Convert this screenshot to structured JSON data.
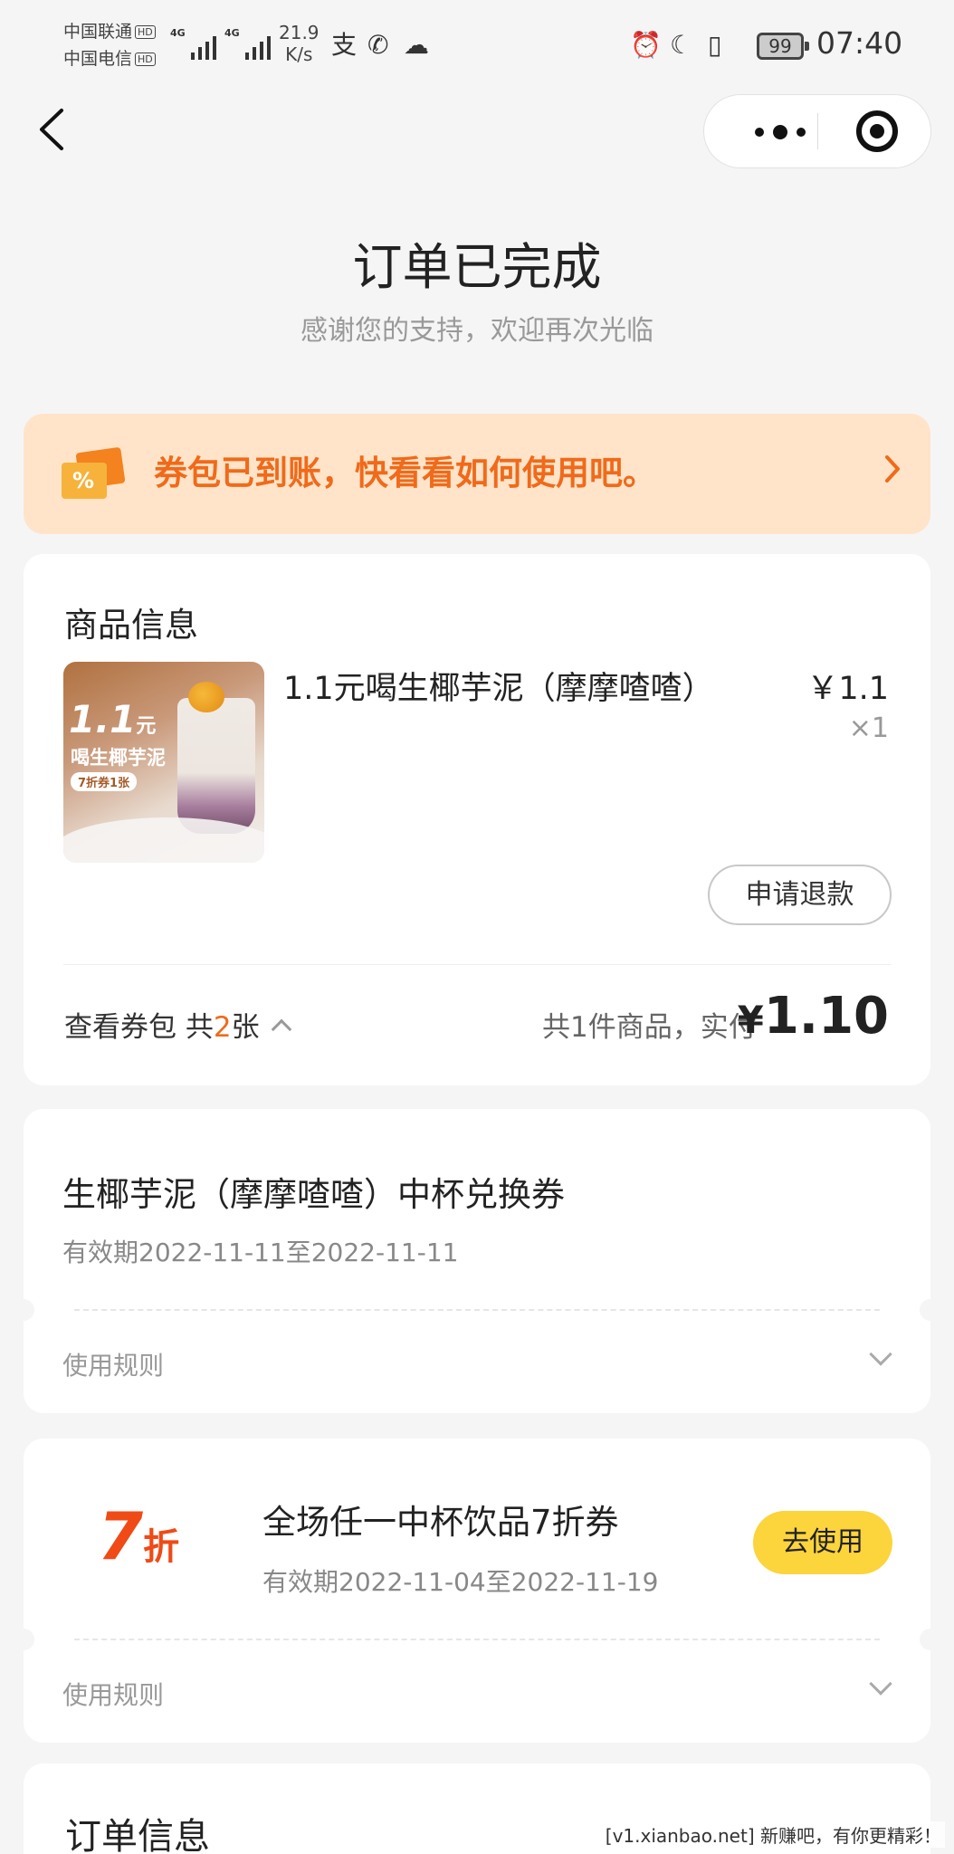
{
  "status_bar": {
    "carrier1": "中国联通",
    "carrier2": "中国电信",
    "hd": "HD",
    "net": "4G",
    "speed_value": "21.9",
    "speed_unit": "K/s",
    "battery": "99",
    "time": "07:40"
  },
  "hero": {
    "title": "订单已完成",
    "subtitle": "感谢您的支持，欢迎再次光临"
  },
  "banner": {
    "text": "券包已到账，快看看如何使用吧。",
    "icon_glyph": "%"
  },
  "product_section": {
    "title": "商品信息",
    "image_big": "1.1",
    "image_yuan": "元",
    "image_line2": "喝生椰芋泥",
    "image_pill": "7折券1张",
    "name": "1.1元喝生椰芋泥（摩摩喳喳）",
    "price": "￥1.1",
    "qty": "×1",
    "refund_label": "申请退款",
    "voucher_prefix": "查看券包 共",
    "voucher_count": "2",
    "voucher_suffix": "张",
    "total_label": "共1件商品，实付",
    "total_symbol": "¥",
    "total_amount": "1.10"
  },
  "vouchers": [
    {
      "title": "生椰芋泥（摩摩喳喳）中杯兑换券",
      "validity": "有效期2022-11-11至2022-11-11",
      "rules_label": "使用规则"
    },
    {
      "discount_num": "7",
      "discount_unit": "折",
      "title": "全场任一中杯饮品7折券",
      "validity": "有效期2022-11-04至2022-11-19",
      "button": "去使用",
      "rules_label": "使用规则"
    }
  ],
  "order_section": {
    "title": "订单信息"
  },
  "watermark": "[v1.xianbao.net] 新赚吧，有你更精彩！",
  "colors": {
    "accent": "#f06a1a",
    "banner_bg": "#ffe4c9",
    "button_yellow": "#fcd43b",
    "discount_red": "#f04a17"
  }
}
